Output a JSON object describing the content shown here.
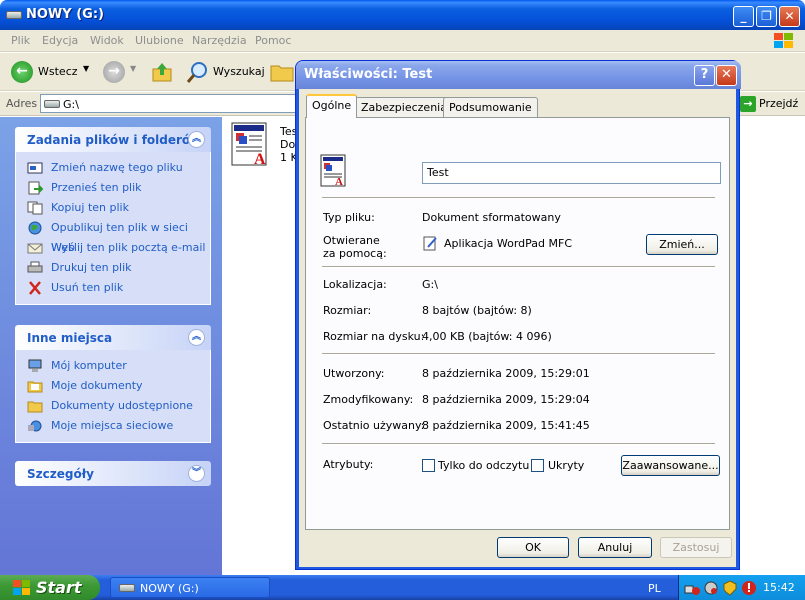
{
  "window": {
    "title": "NOWY (G:)"
  },
  "menu": [
    "Plik",
    "Edycja",
    "Widok",
    "Ulubione",
    "Narzędzia",
    "Pomoc"
  ],
  "toolbar": {
    "back": "Wstecz",
    "search": "Wyszukaj"
  },
  "address": {
    "label": "Adres",
    "value": "G:\\",
    "go": "Przejdź"
  },
  "tasks_panel": {
    "title": "Zadania plików i folderów",
    "items": [
      "Zmień nazwę tego pliku",
      "Przenieś ten plik",
      "Kopiuj ten plik",
      "Opublikuj ten plik w sieci Web",
      "Wyślij ten plik pocztą e-mail",
      "Drukuj ten plik",
      "Usuń ten plik"
    ]
  },
  "places_panel": {
    "title": "Inne miejsca",
    "items": [
      "Mój komputer",
      "Moje dokumenty",
      "Dokumenty udostępnione",
      "Moje miejsca sieciowe"
    ]
  },
  "details_panel": {
    "title": "Szczegóły"
  },
  "file": {
    "line1": "Tes",
    "line2": "Dok",
    "line3": "1 K"
  },
  "dialog": {
    "title": "Właściwości: Test",
    "help": "?",
    "tabs": [
      "Ogólne",
      "Zabezpieczenia",
      "Podsumowanie"
    ],
    "name_value": "Test",
    "type_label": "Typ pliku:",
    "type_value": "Dokument sformatowany",
    "opens_label_1": "Otwierane",
    "opens_label_2": "za pomocą:",
    "opens_value": "Aplikacja WordPad MFC",
    "change_button": "Zmień...",
    "location_label": "Lokalizacja:",
    "location_value": "G:\\",
    "size_label": "Rozmiar:",
    "size_value": "8 bajtów (bajtów: 8)",
    "disk_size_label": "Rozmiar na dysku:",
    "disk_size_value": "4,00 KB (bajtów: 4 096)",
    "created_label": "Utworzony:",
    "created_value": "8 października 2009, 15:29:01",
    "modified_label": "Zmodyfikowany:",
    "modified_value": "8 października 2009, 15:29:04",
    "accessed_label": "Ostatnio używany:",
    "accessed_value": "8 października 2009, 15:41:45",
    "attributes_label": "Atrybuty:",
    "readonly_label": "Tylko do odczytu",
    "hidden_label": "Ukryty",
    "advanced_button": "Zaawansowane...",
    "ok_button": "OK",
    "cancel_button": "Anuluj",
    "apply_button": "Zastosuj"
  },
  "taskbar": {
    "start": "Start",
    "task": "NOWY (G:)",
    "lang": "PL",
    "time": "15:42"
  },
  "colors": {
    "xp_blue": "#245edb",
    "task_link": "#215dc6",
    "start_green": "#3c9a34",
    "dialog_bg": "#ece9d8"
  }
}
